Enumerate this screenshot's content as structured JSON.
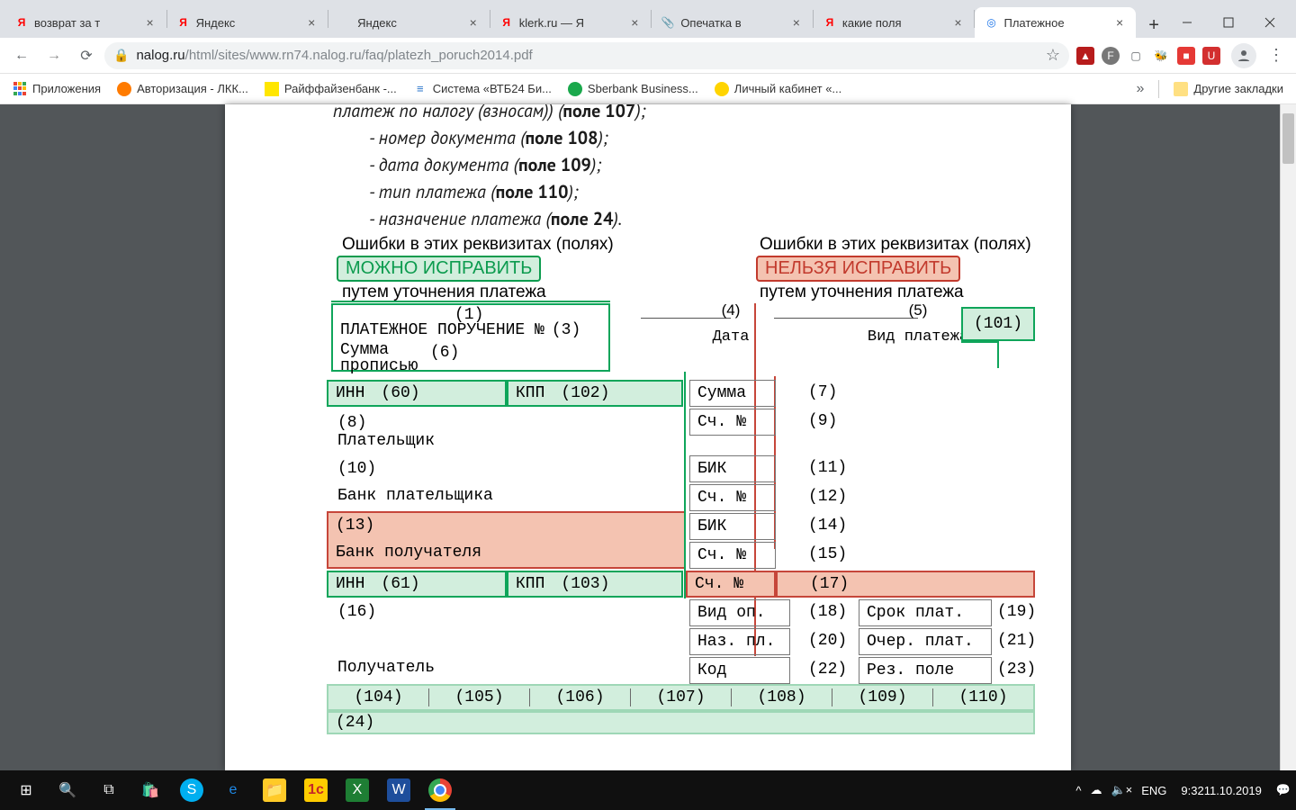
{
  "tabs": [
    {
      "title": "возврат за т",
      "favicon": "Я",
      "faviconColor": "#ff0000",
      "active": false
    },
    {
      "title": "Яндекс",
      "favicon": "Я",
      "faviconColor": "#ff0000",
      "active": false
    },
    {
      "title": "Яндекс",
      "favicon": "",
      "faviconColor": "#bbbbbb",
      "active": false
    },
    {
      "title": "klerk.ru — Я",
      "favicon": "Я",
      "faviconColor": "#ff0000",
      "active": false
    },
    {
      "title": "Опечатка в",
      "favicon": "📎",
      "faviconColor": "#c08a3e",
      "active": false
    },
    {
      "title": "какие поля",
      "favicon": "Я",
      "faviconColor": "#ff0000",
      "active": false
    },
    {
      "title": "Платежное",
      "favicon": "◎",
      "faviconColor": "#1a73e8",
      "active": true
    }
  ],
  "url": {
    "host": "nalog.ru",
    "path": "/html/sites/www.rn74.nalog.ru/faq/platezh_poruch2014.pdf"
  },
  "extensions": [
    {
      "name": "adobe",
      "glyph": "▲",
      "bg": "#b71c1c",
      "fg": "#ffffff"
    },
    {
      "name": "f-circle",
      "glyph": "F",
      "bg": "#777777",
      "fg": "#ffffff"
    },
    {
      "name": "panel",
      "glyph": "▢",
      "bg": "transparent",
      "fg": "#5f6367"
    },
    {
      "name": "pin",
      "glyph": "🐝",
      "bg": "transparent",
      "fg": "#000"
    },
    {
      "name": "red-sq",
      "glyph": "■",
      "bg": "#e53935",
      "fg": "#ffffff"
    },
    {
      "name": "red-u",
      "glyph": "U",
      "bg": "#d32f2f",
      "fg": "#ffffff"
    }
  ],
  "bookmarks": {
    "apps": "Приложения",
    "items": [
      {
        "label": "Авторизация - ЛКК...",
        "favicon": "🦅",
        "bg": "#ff7b00"
      },
      {
        "label": "Райффайзенбанк -...",
        "favicon": "✦",
        "bg": "#ffe600"
      },
      {
        "label": "Система «ВТБ24 Би...",
        "favicon": "≡",
        "bg": "#2b77cc"
      },
      {
        "label": "Sberbank Business...",
        "favicon": "●",
        "bg": "#1aa84c"
      },
      {
        "label": "Личный кабинет «...",
        "favicon": "●",
        "bg": "#ffd400"
      }
    ],
    "other": "Другие закладки"
  },
  "doc": {
    "lines": {
      "l0": "платеж по налогу (взносам)) (",
      "l0b": "поле 107",
      "l0e": ");",
      "l1a": "- номер документа (",
      "l1b": "поле 108",
      "l1e": ");",
      "l2a": "- дата документа (",
      "l2b": "поле 109",
      "l2e": ");",
      "l3a": "- тип платежа (",
      "l3b": "поле 110",
      "l3e": ");",
      "l4a": "- назначение платежа (",
      "l4b": "поле 24",
      "l4e": ")."
    },
    "left": {
      "header": "Ошибки в этих реквизитах (полях)",
      "badge": "МОЖНО ИСПРАВИТЬ",
      "sub": "путем уточнения платежа"
    },
    "right": {
      "header": "Ошибки в этих реквизитах (полях)",
      "badge": "НЕЛЬЗЯ ИСПРАВИТЬ",
      "sub": "путем уточнения платежа"
    },
    "form": {
      "p1_num": "(1)",
      "p1_label": "ПЛАТЕЖНОЕ ПОРУЧЕНИЕ №",
      "p3": "(3)",
      "p4_num": "(4)",
      "p4_label": "Дата",
      "p5_num": "(5)",
      "p5_label": "Вид платежа",
      "p101": "(101)",
      "suma_label1": "Сумма",
      "suma_label2": "прописью",
      "p6": "(6)",
      "inn": "ИНН",
      "p60": "(60)",
      "kpp": "КПП",
      "p102": "(102)",
      "summa": "Сумма",
      "p7": "(7)",
      "p8": "(8)",
      "payer": "Плательщик",
      "sch": "Сч. №",
      "p9": "(9)",
      "p10": "(10)",
      "bik": "БИК",
      "p11": "(11)",
      "bank_payer": "Банк плательщика",
      "p12": "(12)",
      "p13": "(13)",
      "p14": "(14)",
      "bank_recv": "Банк получателя",
      "p15": "(15)",
      "inn2": "ИНН",
      "p61": "(61)",
      "kpp2": "КПП",
      "p103": "(103)",
      "p17": "(17)",
      "p16": "(16)",
      "vidop": "Вид оп.",
      "p18": "(18)",
      "srok": "Срок плат.",
      "p19": "(19)",
      "nazpl": "Наз. пл.",
      "p20": "(20)",
      "ocher": "Очер. плат.",
      "p21": "(21)",
      "recv": "Получатель",
      "kod": "Код",
      "p22": "(22)",
      "rez": "Рез. поле",
      "p23": "(23)",
      "row": {
        "c104": "(104)",
        "c105": "(105)",
        "c106": "(106)",
        "c107": "(107)",
        "c108": "(108)",
        "c109": "(109)",
        "c110": "(110)"
      },
      "p24": "(24)"
    }
  },
  "taskbar": {
    "lang": "ENG",
    "time": "9:32",
    "date": "11.10.2019"
  }
}
